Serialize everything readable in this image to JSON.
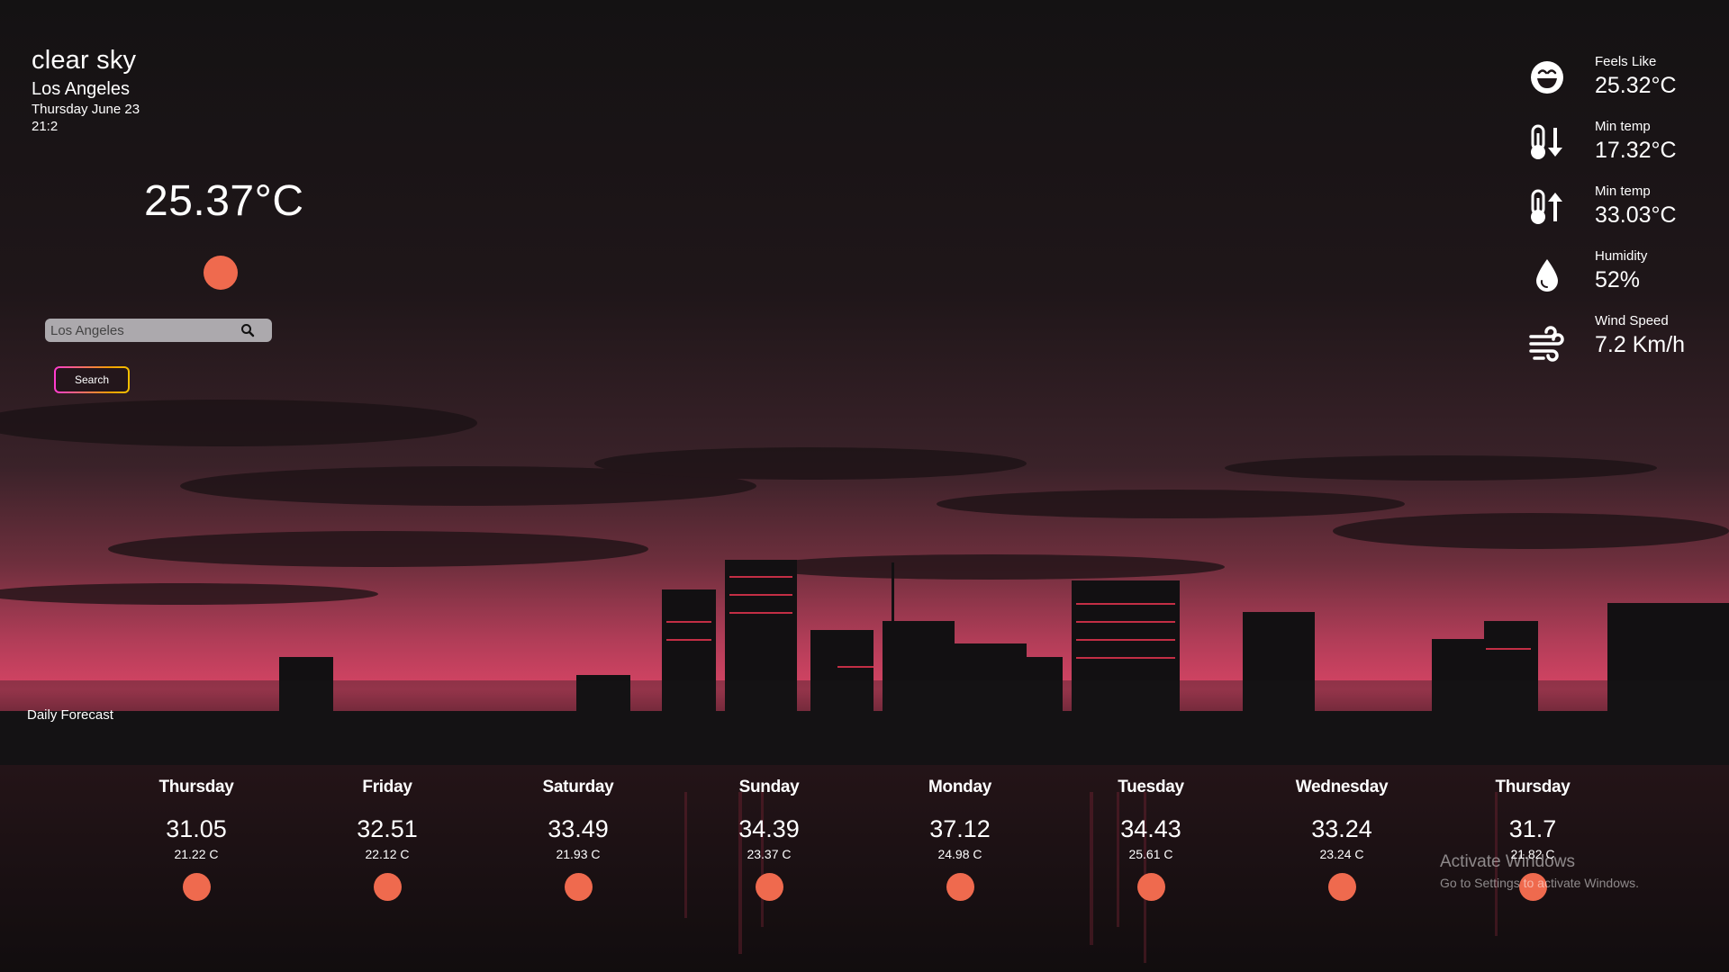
{
  "current": {
    "condition": "clear sky",
    "city": "Los Angeles",
    "date": "Thursday June 23",
    "time": "21:2",
    "temperature": "25.37°C",
    "weather_icon": "sun-icon",
    "sun_color": "#ef6a4e"
  },
  "search": {
    "placeholder": "Los Angeles",
    "value": "",
    "button_label": "Search"
  },
  "stats": [
    {
      "icon": "smiling-face-icon",
      "label": "Feels Like",
      "value": "25.32°C"
    },
    {
      "icon": "thermometer-down-icon",
      "label": "Min temp",
      "value": "17.32°C"
    },
    {
      "icon": "thermometer-up-icon",
      "label": "Min temp",
      "value": "33.03°C"
    },
    {
      "icon": "water-drop-icon",
      "label": "Humidity",
      "value": "52%"
    },
    {
      "icon": "wind-icon",
      "label": "Wind Speed",
      "value": "7.2 Km/h"
    }
  ],
  "forecast": {
    "title": "Daily Forecast",
    "days": [
      {
        "name": "Thursday",
        "max": "31.05",
        "min": "21.22 C"
      },
      {
        "name": "Friday",
        "max": "32.51",
        "min": "22.12 C"
      },
      {
        "name": "Saturday",
        "max": "33.49",
        "min": "21.93 C"
      },
      {
        "name": "Sunday",
        "max": "34.39",
        "min": "23.37 C"
      },
      {
        "name": "Monday",
        "max": "37.12",
        "min": "24.98 C"
      },
      {
        "name": "Tuesday",
        "max": "34.43",
        "min": "25.61 C"
      },
      {
        "name": "Wednesday",
        "max": "33.24",
        "min": "23.24 C"
      },
      {
        "name": "Thursday",
        "max": "31.7",
        "min": "21.82 C"
      }
    ]
  },
  "watermark": {
    "title": "Activate Windows",
    "subtitle": "Go to Settings to activate Windows."
  }
}
